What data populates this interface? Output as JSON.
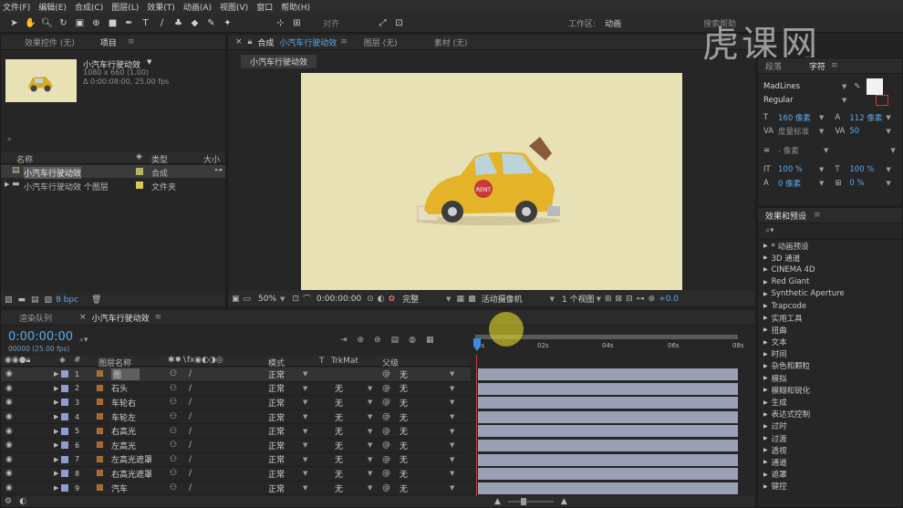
{
  "menu": [
    "文件(F)",
    "编辑(E)",
    "合成(C)",
    "图层(L)",
    "效果(T)",
    "动画(A)",
    "视图(V)",
    "窗口",
    "帮助(H)"
  ],
  "toolbar": {
    "align_label": "对齐",
    "workspace_label": "工作区:",
    "workspace_value": "动画",
    "search_placeholder": "搜索帮助"
  },
  "project": {
    "tabs": [
      "效果控件 (无)",
      "项目"
    ],
    "comp_name": "小汽车行驶动效",
    "comp_size": "1080 x 660 (1.00)",
    "comp_duration": "Δ 0:00:08:00, 25.00 fps",
    "col_name": "名称",
    "col_type": "类型",
    "col_size": "大小",
    "items": [
      {
        "name": "小汽车行驶动效",
        "type": "合成",
        "color": "#b5b56e"
      },
      {
        "name": "小汽车行驶动效 个图层",
        "type": "文件夹",
        "color": "#d9c85a"
      }
    ],
    "bpc": "8 bpc"
  },
  "composition": {
    "tabs": [
      "合成 小汽车行驶动效",
      "图层 (无)",
      "素材 (无)"
    ],
    "active_tab_prefix": "合成",
    "active_tab_name": "小汽车行驶动效",
    "sub_tab": "小汽车行驶动效",
    "zoom": "50%",
    "timecode": "0:00:00:00",
    "resolution": "完整",
    "camera": "活动摄像机",
    "views": "1 个视图",
    "exposure": "+0.0",
    "bg_color": "#e7e1b5",
    "car_sign": "RENT"
  },
  "character": {
    "tabs": [
      "段落",
      "字符"
    ],
    "font": "MadLines",
    "style": "Regular",
    "size": "160 像素",
    "leading": "112 像素",
    "kerning": "度量标准",
    "tracking": "50",
    "stroke": "- 像素",
    "vscale": "100 %",
    "hscale": "100 %",
    "baseline": "0 像素",
    "tsume": "0 %"
  },
  "effects": {
    "title": "效果和预设",
    "items": [
      "* 动画预设",
      "3D 通道",
      "CINEMA 4D",
      "Red Giant",
      "Synthetic Aperture",
      "Trapcode",
      "实用工具",
      "扭曲",
      "文本",
      "时间",
      "杂色和颗粒",
      "模拟",
      "模糊和锐化",
      "生成",
      "表达式控制",
      "过时",
      "过渡",
      "透视",
      "通道",
      "遮罩",
      "键控"
    ]
  },
  "timeline": {
    "tabs": [
      "渲染队列",
      "小汽车行驶动效"
    ],
    "timecode": "0:00:00:00",
    "frames": "00000 (25.00 fps)",
    "col_layer": "图层名称",
    "col_mode": "模式",
    "col_t": "T",
    "col_trk": "TrkMat",
    "col_parent": "父级",
    "ruler": [
      "0s",
      "02s",
      "04s",
      "06s",
      "08s"
    ],
    "layers": [
      {
        "num": "1",
        "name": "图",
        "mode": "正常",
        "trk": "",
        "parent": "无"
      },
      {
        "num": "2",
        "name": "石头",
        "mode": "正常",
        "trk": "无",
        "parent": "无"
      },
      {
        "num": "3",
        "name": "车轮右",
        "mode": "正常",
        "trk": "无",
        "parent": "无"
      },
      {
        "num": "4",
        "name": "车轮左",
        "mode": "正常",
        "trk": "无",
        "parent": "无"
      },
      {
        "num": "5",
        "name": "右高光",
        "mode": "正常",
        "trk": "无",
        "parent": "无"
      },
      {
        "num": "6",
        "name": "左高光",
        "mode": "正常",
        "trk": "无",
        "parent": "无"
      },
      {
        "num": "7",
        "name": "左高光遮罩",
        "mode": "正常",
        "trk": "无",
        "parent": "无"
      },
      {
        "num": "8",
        "name": "右高光遮罩",
        "mode": "正常",
        "trk": "无",
        "parent": "无"
      },
      {
        "num": "9",
        "name": "汽车",
        "mode": "正常",
        "trk": "无",
        "parent": "无"
      }
    ]
  },
  "watermark": "虎课网"
}
